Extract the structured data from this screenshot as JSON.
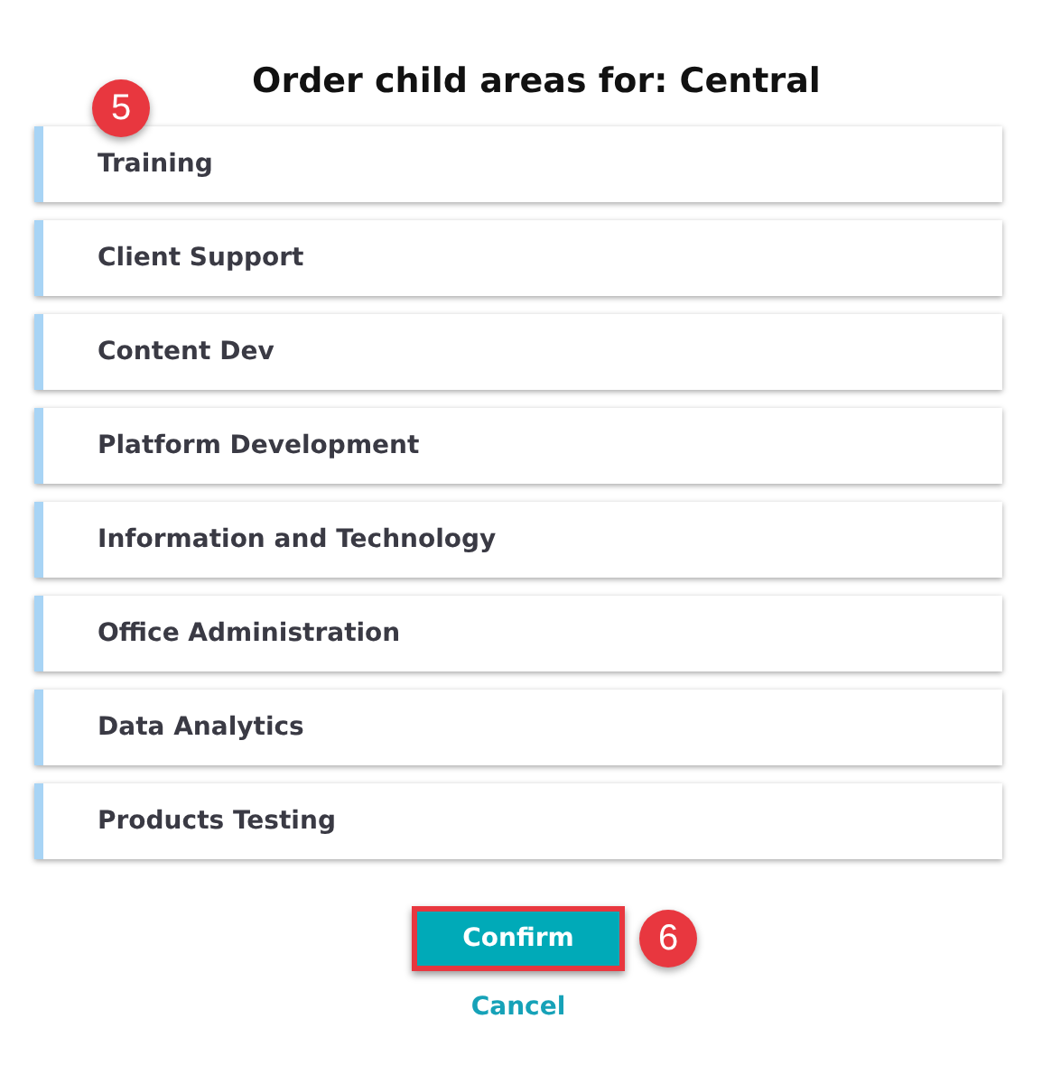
{
  "title": "Order child areas for: Central",
  "areas": [
    {
      "label": "Training"
    },
    {
      "label": "Client Support"
    },
    {
      "label": "Content Dev"
    },
    {
      "label": "Platform Development"
    },
    {
      "label": "Information and Technology"
    },
    {
      "label": "Office Administration"
    },
    {
      "label": "Data Analytics"
    },
    {
      "label": "Products Testing"
    }
  ],
  "confirm": {
    "label": "Confirm",
    "highlighted": true,
    "callout": "6"
  },
  "cancel": {
    "label": "Cancel"
  },
  "list_callout": "5"
}
